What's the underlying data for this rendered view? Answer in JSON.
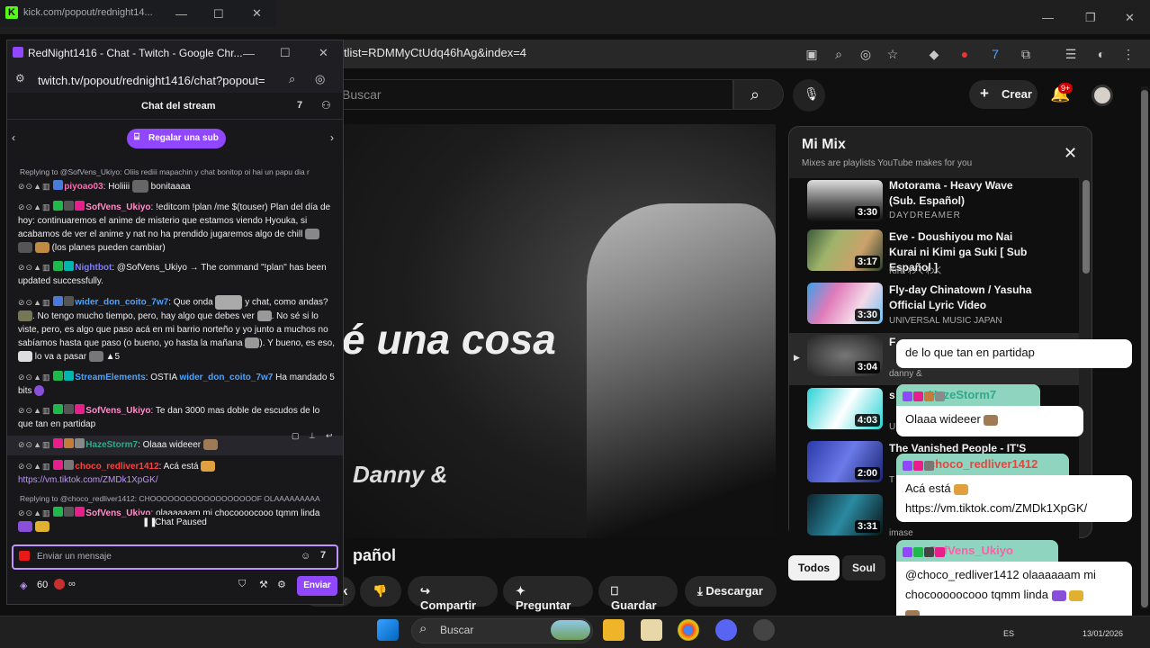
{
  "browser": {
    "url_fragment": "tlist=RDMMyCtUdq46hAg&index=4"
  },
  "youtube": {
    "search_placeholder": "Buscar",
    "create_label": "Crear",
    "notif_count": "9+",
    "video_overlay_text": "é una cosa",
    "video_overlay_sub": "Danny &",
    "video_title_fragment": "pañol",
    "actions": [
      "k",
      "Compartir",
      "Preguntar",
      "Guardar",
      "Descargar"
    ],
    "chips": [
      "Todos",
      "Soul"
    ]
  },
  "mix": {
    "title": "Mi Mix",
    "subtitle": "Mixes are playlists YouTube makes for you",
    "items": [
      {
        "title": "Motorama - Heavy Wave (Sub. Español)",
        "channel": "DAYDREAMER",
        "duration": "3:30"
      },
      {
        "title": "Eve - Doushiyou mo Nai Kurai ni Kimi ga Suki [ Sub Español ]",
        "channel": "Kira わくわく",
        "duration": "3:17"
      },
      {
        "title": "Fly-day Chinatown / Yasuha Official Lyric Video",
        "channel": "UNIVERSAL MUSIC JAPAN",
        "duration": "3:30"
      },
      {
        "title": "F",
        "channel": "danny &",
        "duration": "3:04"
      },
      {
        "title": "s",
        "channel": "U",
        "duration": "4:03"
      },
      {
        "title": "The Vanished People - IT'S",
        "channel": "T",
        "duration": "2:00"
      },
      {
        "title": "",
        "channel": "imase",
        "duration": "3:31"
      }
    ]
  },
  "overlay": {
    "bubbles": [
      {
        "name": "",
        "text": "de lo que tan en partidap"
      },
      {
        "name": "HazeStorm7",
        "text": "Olaaa wideeer"
      },
      {
        "name": "choco_redliver1412",
        "text": "Acá está",
        "text2": "https://vm.tiktok.com/ZMDk1XpGK/"
      },
      {
        "name": "SofVens_Ukiyo",
        "text": "@choco_redliver1412 olaaaaaam mi",
        "text2": "chocooooocooo tqmm linda"
      }
    ]
  },
  "kick": {
    "title": "kick.com/popout/rednight14..."
  },
  "twitch": {
    "window_title": "RedNight1416 - Chat - Twitch - Google Chr...",
    "url": "twitch.tv/popout/rednight1416/chat?popout=",
    "header": "Chat del stream",
    "gift_label": "Regalar una sub",
    "messages": {
      "reply1": "Replying to @SofVens_Ukiyo: Oliis rediii mapachin y chat bonitop oi hai un papu dia r",
      "m1_user": "piyoao03",
      "m1_text": ": Holiiii",
      "m1_text2": "bonitaaaa",
      "m2_user": "SofVens_Ukiyo",
      "m2_text": ": !editcom !plan /me $(touser) Plan del día de hoy: continuaremos el anime de misterio que estamos viendo Hyouka, si acabamos de ver el anime y nat no ha prendido jugaremos algo de chill",
      "m2_text2": "(los planes pueden cambiar)",
      "m3_user": "Nightbot",
      "m3_text": ": @SofVens_Ukiyo → The command \"!plan\" has been updated successfully.",
      "m4_user": "wider_don_coito_7w7",
      "m4_text": ": Que onda",
      "m4_text2": "y chat, como andas?",
      "m4_text3": ". No tengo mucho tiempo, pero, hay algo que debes ver",
      "m4_text4": ". No sé si lo viste, pero, es algo que paso acá en mi barrio norteño y yo junto a muchos no sabíamos hasta que paso (o bueno, yo hasta la mañana",
      "m4_text5": "). Y bueno, es eso,",
      "m4_text6": "lo va a pasar",
      "m4_count": "5",
      "m5_user": "StreamElements",
      "m5_text": ": OSTIA",
      "m5_user2": "wider_don_coito_7w7",
      "m5_text2": "Ha mandado 5 bits",
      "m6_user": "SofVens_Ukiyo",
      "m6_text": ": Te dan 3000 mas doble de escudos de lo que tan en partidap",
      "m7_user": "HazeStorm7",
      "m7_text": ": Olaaa wideeer",
      "m8_user": "choco_redliver1412",
      "m8_text": ": Acá está",
      "m8_link": "https://vm.tiktok.com/ZMDk1XpGK/",
      "reply2": "Replying to @choco_redliver1412: CHOOOOOOOOOOOOOOOOOOF OLAAAAAAAAA",
      "m9_user": "SofVens_Ukiyo",
      "m9_text": ": olaaaaaam mi chocoooocooo tqmm linda"
    },
    "paused_label": "Chat Paused",
    "input_placeholder": "Enviar un mensaje",
    "points": "60",
    "infinity": "∞",
    "send_label": "Enviar"
  },
  "taskbar": {
    "search_placeholder": "Buscar",
    "lang": "ES",
    "date": "13/01/2026"
  },
  "colors": {
    "twitch_purple": "#9147ff",
    "kick_green": "#53fc18",
    "yt_red": "#cc0000"
  }
}
